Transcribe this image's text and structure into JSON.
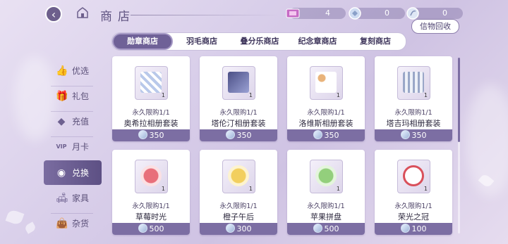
{
  "header": {
    "title": "商店"
  },
  "currencies": [
    {
      "name": "ticket-currency",
      "value": "4"
    },
    {
      "name": "medal-currency",
      "value": "0"
    },
    {
      "name": "feather-currency",
      "value": "0"
    }
  ],
  "recycle_label": "信物回收",
  "sidebar": {
    "items": [
      {
        "label": "优选",
        "icon": "thumbs-up-icon"
      },
      {
        "label": "礼包",
        "icon": "gift-icon"
      },
      {
        "label": "充值",
        "icon": "diamond-icon"
      },
      {
        "label": "月卡",
        "icon": "vip-card-icon"
      },
      {
        "label": "兑换",
        "icon": "exchange-icon",
        "active": true
      },
      {
        "label": "家具",
        "icon": "sofa-icon"
      },
      {
        "label": "杂货",
        "icon": "bag-icon"
      }
    ]
  },
  "tabs": [
    {
      "label": "勋章商店",
      "active": true
    },
    {
      "label": "羽毛商店"
    },
    {
      "label": "叠分乐商店"
    },
    {
      "label": "纪念章商店"
    },
    {
      "label": "复刻商店"
    }
  ],
  "items": [
    {
      "limit": "永久限购1/1",
      "name": "奥希拉相册套装",
      "price": "350",
      "qty": "1",
      "color": "#b9c9ea"
    },
    {
      "limit": "永久限购1/1",
      "name": "塔伦汀相册套装",
      "price": "350",
      "qty": "1",
      "color": "#4b4f86"
    },
    {
      "limit": "永久限购1/1",
      "name": "洛维斯相册套装",
      "price": "350",
      "qty": "1",
      "color": "#e9b37a"
    },
    {
      "limit": "永久限购1/1",
      "name": "塔吉玛相册套装",
      "price": "350",
      "qty": "1",
      "color": "#9aa7c8"
    },
    {
      "limit": "永久限购1/1",
      "name": "草莓时光",
      "price": "500",
      "qty": "1",
      "color": "#e86f7a"
    },
    {
      "limit": "永久限购1/1",
      "name": "橙子午后",
      "price": "300",
      "qty": "1",
      "color": "#f2cf5e"
    },
    {
      "limit": "永久限购1/1",
      "name": "苹果拼盘",
      "price": "500",
      "qty": "1",
      "color": "#93cf7c"
    },
    {
      "limit": "永久限购1/1",
      "name": "荣光之冠",
      "price": "100",
      "qty": "1",
      "color": "#d9505b"
    }
  ]
}
